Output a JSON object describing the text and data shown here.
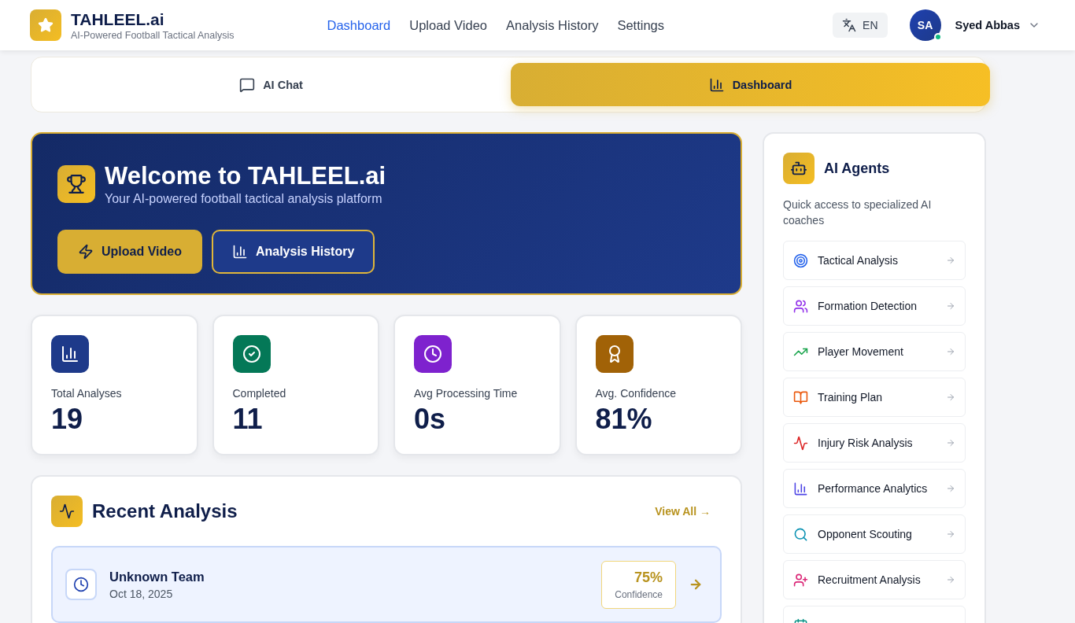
{
  "brand": {
    "name": "TAHLEEL.ai",
    "tagline": "AI-Powered Football Tactical Analysis"
  },
  "nav": [
    {
      "label": "Dashboard",
      "selected": true
    },
    {
      "label": "Upload Video",
      "selected": false
    },
    {
      "label": "Analysis History",
      "selected": false
    },
    {
      "label": "Settings",
      "selected": false
    }
  ],
  "language": "EN",
  "user": {
    "initials": "SA",
    "name": "Syed Abbas",
    "online": true
  },
  "view_tabs": [
    {
      "label": "AI Chat",
      "selected": false
    },
    {
      "label": "Dashboard",
      "selected": true
    }
  ],
  "welcome": {
    "title": "Welcome to TAHLEEL.ai",
    "subtitle": "Your AI-powered football tactical analysis platform",
    "buttons": [
      {
        "label": "Upload Video",
        "kind": "primary"
      },
      {
        "label": "Analysis History",
        "kind": "secondary"
      }
    ]
  },
  "stats": [
    {
      "label": "Total Analyses",
      "value": "19",
      "color": "#1e3a8a"
    },
    {
      "label": "Completed",
      "value": "11",
      "color": "#047857"
    },
    {
      "label": "Avg Processing Time",
      "value": "0s",
      "color": "#7e22ce"
    },
    {
      "label": "Avg. Confidence",
      "value": "81%",
      "color": "#a16207"
    }
  ],
  "recent": {
    "title": "Recent Analysis",
    "view_all": "View All →",
    "items": [
      {
        "team": "Unknown Team",
        "date": "Oct 18, 2025",
        "confidence": "75%",
        "confidence_label": "Confidence"
      }
    ]
  },
  "agents": {
    "title": "AI Agents",
    "subtitle": "Quick access to specialized AI coaches",
    "items": [
      {
        "label": "Tactical Analysis",
        "color": "#2563eb"
      },
      {
        "label": "Formation Detection",
        "color": "#9333ea"
      },
      {
        "label": "Player Movement",
        "color": "#16a34a"
      },
      {
        "label": "Training Plan",
        "color": "#ea580c"
      },
      {
        "label": "Injury Risk Analysis",
        "color": "#dc2626"
      },
      {
        "label": "Performance Analytics",
        "color": "#4f46e5"
      },
      {
        "label": "Opponent Scouting",
        "color": "#0891b2"
      },
      {
        "label": "Recruitment Analysis",
        "color": "#db2777"
      },
      {
        "color": "#0d9488"
      }
    ]
  }
}
